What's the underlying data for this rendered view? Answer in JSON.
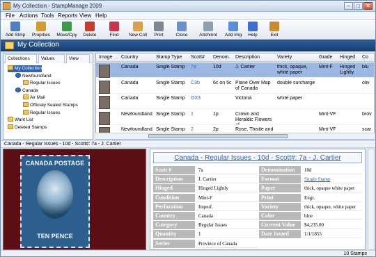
{
  "window": {
    "title": "My Collection - StampManage 2009",
    "minimize": "–",
    "maximize": "□",
    "close": "✕"
  },
  "menu": [
    "File",
    "Actions",
    "Tools",
    "Reports",
    "View",
    "Help"
  ],
  "toolbar": [
    {
      "label": "Add Stmp",
      "icon": "add-stamp-icon",
      "color": "#4f7fc4"
    },
    {
      "label": "Proprties",
      "icon": "properties-icon",
      "color": "#d49a32"
    },
    {
      "label": "Move/Cpy",
      "icon": "move-copy-icon",
      "color": "#3d9a4c"
    },
    {
      "label": "Delete",
      "icon": "delete-icon",
      "color": "#c93a2e"
    },
    {
      "label": "Find",
      "icon": "find-icon",
      "color": "#c9334b"
    },
    {
      "label": "New Coll",
      "icon": "new-collection-icon",
      "color": "#d9a24a"
    },
    {
      "label": "Print",
      "icon": "print-icon",
      "color": "#7c8793"
    },
    {
      "label": "Clone",
      "icon": "clone-icon",
      "color": "#6c91c9"
    },
    {
      "label": "Attchmnt",
      "icon": "attachment-icon",
      "color": "#8fa0b3"
    },
    {
      "label": "Add Img",
      "icon": "add-image-icon",
      "color": "#5a8fd6"
    },
    {
      "label": "Help",
      "icon": "help-icon",
      "color": "#3b6fd1"
    },
    {
      "label": "Exit",
      "icon": "exit-icon",
      "color": "#c98c2c"
    }
  ],
  "banner": {
    "title": "My Collection"
  },
  "tabs": [
    "Collections",
    "Values",
    "View"
  ],
  "tree": [
    {
      "label": "My Collection",
      "level": 0,
      "icon": "folder-icon"
    },
    {
      "label": "Newfoundland",
      "level": 1,
      "icon": "globe-icon"
    },
    {
      "label": "Regular Issues",
      "level": 2,
      "icon": "folder-icon"
    },
    {
      "label": "Canada",
      "level": 1,
      "icon": "globe-icon"
    },
    {
      "label": "Air Mail",
      "level": 2,
      "icon": "folder-icon"
    },
    {
      "label": "Officialy Sealed Stamps",
      "level": 2,
      "icon": "folder-icon"
    },
    {
      "label": "Regular Issues",
      "level": 2,
      "icon": "folder-icon"
    },
    {
      "label": "Want List",
      "level": 0,
      "icon": "folder-icon"
    },
    {
      "label": "Deleted Stamps",
      "level": 0,
      "icon": "folder-icon"
    }
  ],
  "grid": {
    "columns": [
      "Image",
      "Country",
      "Stamp Type",
      "Scott#",
      "Denom.",
      "Description",
      "Variety",
      "Grade",
      "Hinged",
      "Co"
    ],
    "rows": [
      {
        "country": "Canada",
        "type": "Single Stamp",
        "scott": "7a",
        "denom": "10d",
        "desc": "J. Cartier",
        "variety": "thick, opaque, white paper",
        "grade": "Mint-F",
        "hinged": "Hinged Lightly",
        "color": "blu"
      },
      {
        "country": "Canada",
        "type": "Single Stamp",
        "scott": "C3b",
        "denom": "6c on 5c",
        "desc": "Plane Over Map of Canada",
        "variety": "double surcharge",
        "grade": "",
        "hinged": "",
        "color": "oliv"
      },
      {
        "country": "Canada",
        "type": "Single Stamp",
        "scott": "OX3",
        "denom": "",
        "desc": "Victoria",
        "variety": "white paper",
        "grade": "",
        "hinged": "",
        "color": ""
      },
      {
        "country": "Newfoundland",
        "type": "Single Stamp",
        "scott": "1",
        "denom": "1p",
        "desc": "Crown and Heraldic Flowers of",
        "variety": "",
        "grade": "Mint-VF",
        "hinged": "",
        "color": "brov"
      },
      {
        "country": "Newfoundland",
        "type": "Single Stamp",
        "scott": "2",
        "denom": "2p",
        "desc": "Rose, Thistle and Shamrock",
        "variety": "",
        "grade": "Mint-VF",
        "hinged": "",
        "color": "scar"
      }
    ]
  },
  "status_line": "Canada - Regular Issues - 10d - Scott#: 7a - J. Cartier",
  "stamp_image": {
    "top_text": "CANADA POSTAGE",
    "bottom_text": "TEN PENCE"
  },
  "detail": {
    "title": "Canada - Regular Issues - 10d - Scott#: 7a - J. Cartier",
    "left": [
      {
        "label": "Scott #",
        "value": "7a"
      },
      {
        "label": "Description",
        "value": "J. Cartier"
      },
      {
        "label": "Hinged",
        "value": "Hinged Lightly"
      },
      {
        "label": "Condition",
        "value": "Mint-F"
      },
      {
        "label": "Perforation",
        "value": "Imperf."
      },
      {
        "label": "Country",
        "value": "Canada"
      },
      {
        "label": "Category",
        "value": "Regular Issues"
      },
      {
        "label": "Quantity",
        "value": "1"
      },
      {
        "label": "Series",
        "value": "Province of Canada"
      }
    ],
    "right": [
      {
        "label": "Denomination",
        "value": "10d"
      },
      {
        "label": "Format",
        "value": "Single Stamp"
      },
      {
        "label": "Paper",
        "value": "thick, opaque white paper"
      },
      {
        "label": "Print",
        "value": "Engr."
      },
      {
        "label": "Variety",
        "value": "thick, opaque, white paper"
      },
      {
        "label": "Color",
        "value": "blue"
      },
      {
        "label": "Current Value",
        "value": "$4,235.00"
      },
      {
        "label": "Date Issued",
        "value": "1/1/1855"
      }
    ]
  },
  "statusbar": "10 Stamps"
}
